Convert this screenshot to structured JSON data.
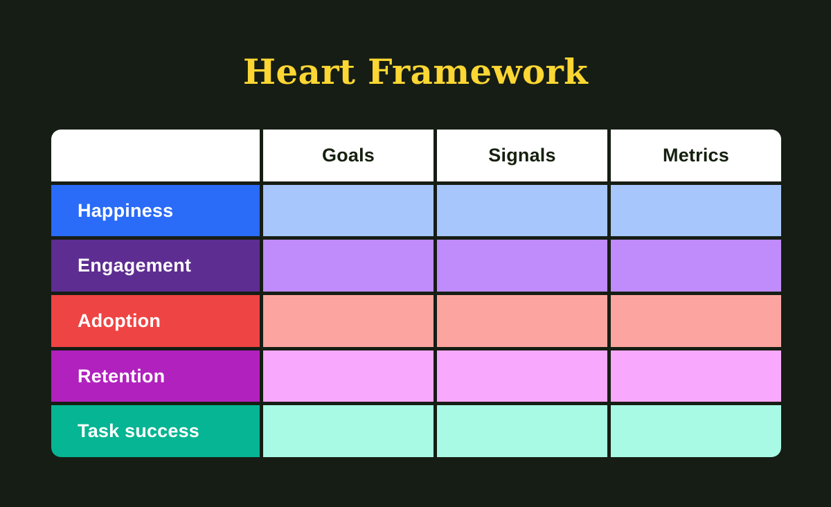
{
  "page": {
    "title": "Heart Framework",
    "background_color": "#161d14",
    "title_color": "#fcd633"
  },
  "table": {
    "corner_label_text": "",
    "column_headers": [
      "Goals",
      "Signals",
      "Metrics"
    ],
    "header_background": "#ffffff",
    "header_text_color": "#15200f",
    "rows": [
      {
        "label": "Happiness",
        "label_color": "#2a6bf7",
        "cell_color": "#a7c6fb",
        "cells": [
          "",
          "",
          ""
        ]
      },
      {
        "label": "Engagement",
        "label_color": "#5e2d91",
        "cell_color": "#c08bfa",
        "cells": [
          "",
          "",
          ""
        ]
      },
      {
        "label": "Adoption",
        "label_color": "#ef4444",
        "cell_color": "#fca5a0",
        "cells": [
          "",
          "",
          ""
        ]
      },
      {
        "label": "Retention",
        "label_color": "#b121be",
        "cell_color": "#f8a8fd",
        "cells": [
          "",
          "",
          ""
        ]
      },
      {
        "label": "Task success",
        "label_color": "#06b593",
        "cell_color": "#a8fae4",
        "cells": [
          "",
          "",
          ""
        ]
      }
    ]
  }
}
